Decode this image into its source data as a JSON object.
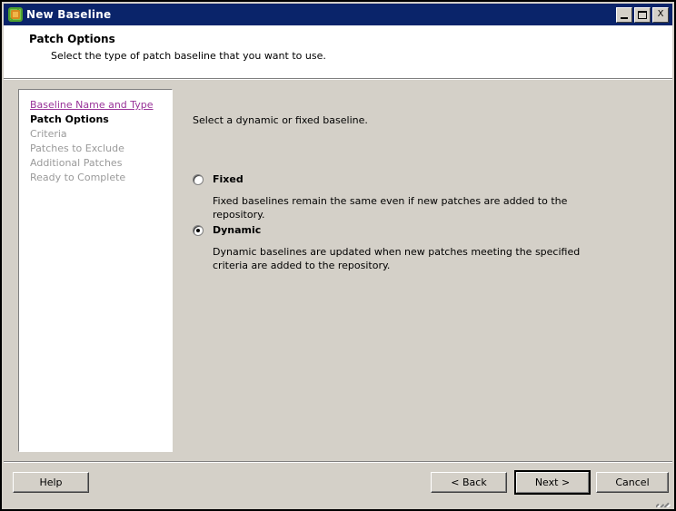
{
  "window": {
    "title": "New Baseline",
    "icon": "baseline-icon",
    "controls": {
      "minimize": "minimize-button",
      "maximize": "maximize-button",
      "close_label": "X"
    }
  },
  "header": {
    "title": "Patch Options",
    "subtitle": "Select the type of patch baseline that you want to use."
  },
  "sidebar": {
    "items": [
      {
        "label": "Baseline Name and Type",
        "state": "visited"
      },
      {
        "label": "Patch Options",
        "state": "current"
      },
      {
        "label": "Criteria",
        "state": "pending"
      },
      {
        "label": "Patches to Exclude",
        "state": "pending"
      },
      {
        "label": "Additional Patches",
        "state": "pending"
      },
      {
        "label": "Ready to Complete",
        "state": "pending"
      }
    ]
  },
  "content": {
    "intro": "Select a dynamic or fixed baseline.",
    "options": [
      {
        "label": "Fixed",
        "selected": false,
        "description": "Fixed baselines remain the same even if new patches are added to the repository."
      },
      {
        "label": "Dynamic",
        "selected": true,
        "description": "Dynamic baselines are updated when new patches meeting the specified criteria are added to the repository."
      }
    ]
  },
  "footer": {
    "help_label": "Help",
    "back_label": "< Back",
    "next_label": "Next >",
    "cancel_label": "Cancel"
  },
  "colors": {
    "titlebar": "#0a246a",
    "dialog_face": "#d4d0c8",
    "visited_link": "#993399",
    "pending_text": "#9a9a9a"
  }
}
